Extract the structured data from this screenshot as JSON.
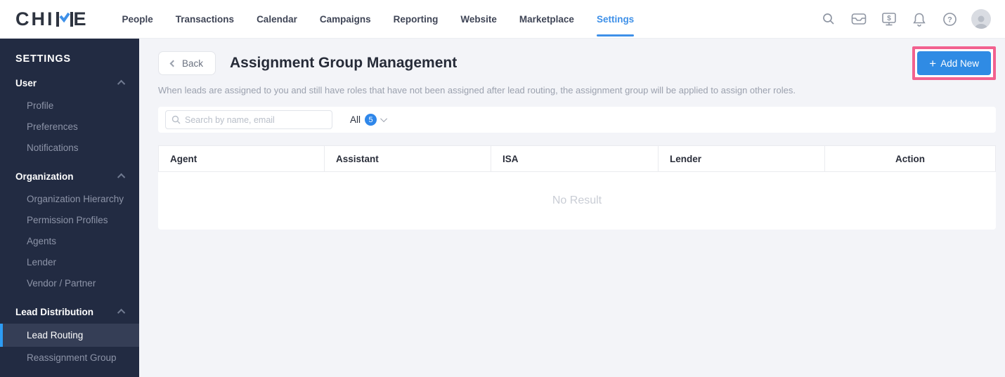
{
  "nav": {
    "logo": {
      "prefix": "CHI",
      "suffix": "E"
    },
    "items": [
      {
        "label": "People",
        "active": false
      },
      {
        "label": "Transactions",
        "active": false
      },
      {
        "label": "Calendar",
        "active": false
      },
      {
        "label": "Campaigns",
        "active": false
      },
      {
        "label": "Reporting",
        "active": false
      },
      {
        "label": "Website",
        "active": false
      },
      {
        "label": "Marketplace",
        "active": false
      },
      {
        "label": "Settings",
        "active": true
      }
    ]
  },
  "sidebar": {
    "title": "SETTINGS",
    "sections": [
      {
        "label": "User",
        "items": [
          {
            "label": "Profile"
          },
          {
            "label": "Preferences"
          },
          {
            "label": "Notifications"
          }
        ]
      },
      {
        "label": "Organization",
        "items": [
          {
            "label": "Organization Hierarchy"
          },
          {
            "label": "Permission Profiles"
          },
          {
            "label": "Agents"
          },
          {
            "label": "Lender"
          },
          {
            "label": "Vendor / Partner"
          }
        ]
      },
      {
        "label": "Lead Distribution",
        "items": [
          {
            "label": "Lead Routing",
            "active": true
          },
          {
            "label": "Reassignment Group"
          }
        ]
      }
    ]
  },
  "main": {
    "back_label": "Back",
    "title": "Assignment Group Management",
    "description": "When leads are assigned to you and still have roles that have not been assigned after lead routing, the assignment group will be applied to assign other roles.",
    "add_new": {
      "plus": "+",
      "label": "Add New"
    },
    "search": {
      "placeholder": "Search by name, email"
    },
    "filter": {
      "label": "All",
      "count": "5"
    },
    "table": {
      "columns": [
        "Agent",
        "Assistant",
        "ISA",
        "Lender",
        "Action"
      ],
      "empty": "No Result"
    }
  },
  "colors": {
    "accent_blue": "#2f8be4",
    "active_nav_blue": "#3e90e8",
    "annotation_pink": "#f2618f",
    "sidebar_bg": "#222b42",
    "sidebar_active_bg": "#353e56",
    "badge_blue": "#2f87ea"
  }
}
